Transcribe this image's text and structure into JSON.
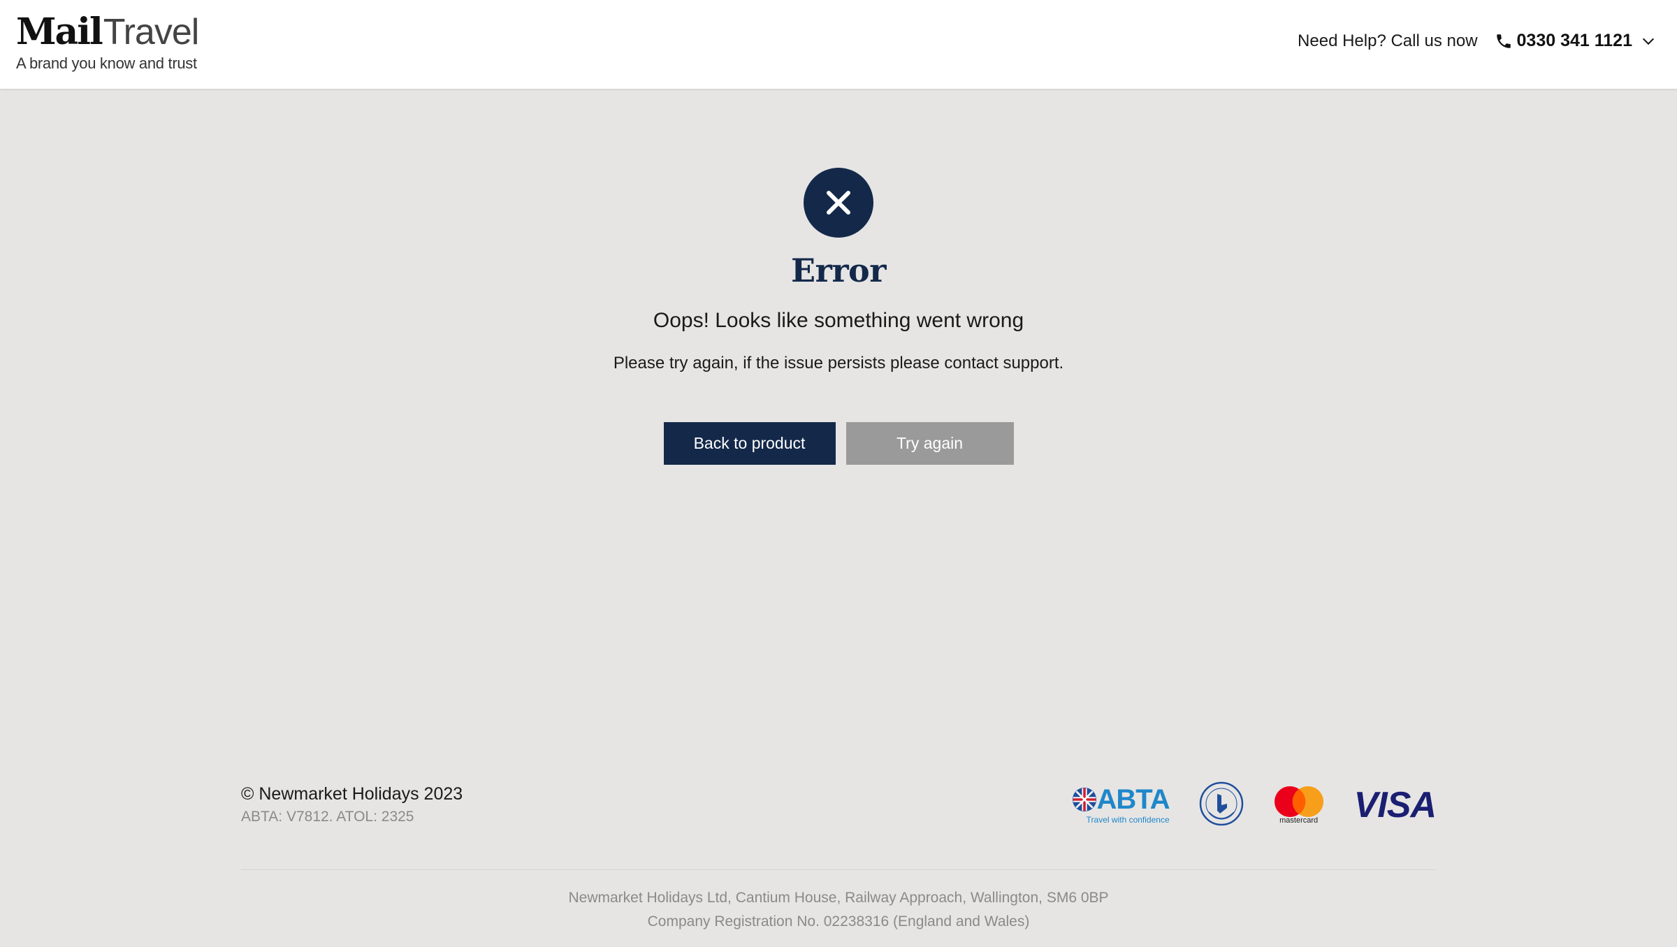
{
  "header": {
    "logo_mail": "Mail",
    "logo_travel": "Travel",
    "logo_tagline": "A brand you know and trust",
    "help_text": "Need Help? Call us now",
    "phone_number": "0330 341 1121",
    "phone_icon": "phone-icon",
    "dropdown_icon": "chevron-down-icon"
  },
  "error": {
    "icon": "close-icon",
    "title": "Error",
    "subtitle": "Oops! Looks like something went wrong",
    "description": "Please try again, if the issue persists please contact support.",
    "back_button": "Back to product",
    "retry_button": "Try again"
  },
  "footer": {
    "copyright": "© Newmarket Holidays 2023",
    "licence": "ABTA: V7812. ATOL: 2325",
    "badges": {
      "abta": "ABTA",
      "abta_sub": "Travel with confidence",
      "atol": "ATOL protected",
      "mastercard": "mastercard",
      "visa": "VISA"
    },
    "company_address": "Newmarket Holidays Ltd, Cantium House, Railway Approach, Wallington, SM6 0BP",
    "company_reg": "Company Registration No. 02238316 (England and Wales)"
  },
  "colors": {
    "navy": "#14294a",
    "background": "#e6e5e4",
    "button_grey": "#9a9a9a",
    "abta_blue": "#1f87c9",
    "visa_blue": "#1a1f71"
  }
}
